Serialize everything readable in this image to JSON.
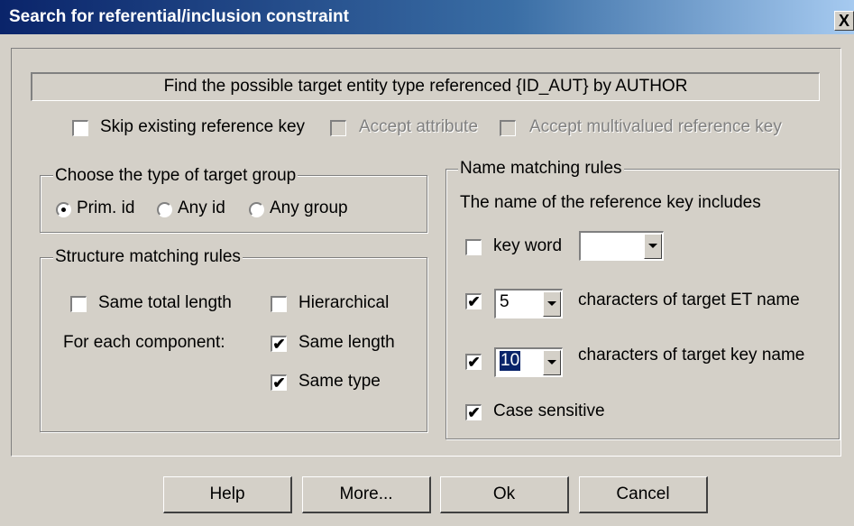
{
  "window": {
    "title": "Search for referential/inclusion constraint",
    "close_label": "X"
  },
  "header_text": "Find the possible target entity type referenced {ID_AUT} by AUTHOR",
  "options": {
    "skip_existing": {
      "label": "Skip existing reference key",
      "checked": false
    },
    "accept_attribute": {
      "label": "Accept attribute",
      "checked": false,
      "enabled": false
    },
    "accept_multivalued": {
      "label": "Accept multivalued reference key",
      "checked": false,
      "enabled": false
    }
  },
  "target_group": {
    "title": "Choose the type of target group",
    "options": [
      "Prim. id",
      "Any id",
      "Any group"
    ],
    "selected": "Prim. id"
  },
  "structure": {
    "title": "Structure matching rules",
    "same_total_length": {
      "label": "Same total length",
      "checked": false
    },
    "hierarchical": {
      "label": "Hierarchical",
      "checked": false
    },
    "for_each_label": "For each component:",
    "same_length": {
      "label": "Same length",
      "checked": true
    },
    "same_type": {
      "label": "Same type",
      "checked": true
    }
  },
  "name_matching": {
    "title": "Name matching rules",
    "description": "The name of the reference key includes",
    "key_word": {
      "label": "key word",
      "checked": false,
      "value": ""
    },
    "target_et": {
      "checked": true,
      "value": "5",
      "label": "characters of target ET name"
    },
    "target_key": {
      "checked": true,
      "value": "10",
      "label": "characters of target key name"
    },
    "case_sensitive": {
      "label": "Case sensitive",
      "checked": true
    }
  },
  "buttons": {
    "help": "Help",
    "more": "More...",
    "ok": "Ok",
    "cancel": "Cancel"
  },
  "check_mark": "✔"
}
